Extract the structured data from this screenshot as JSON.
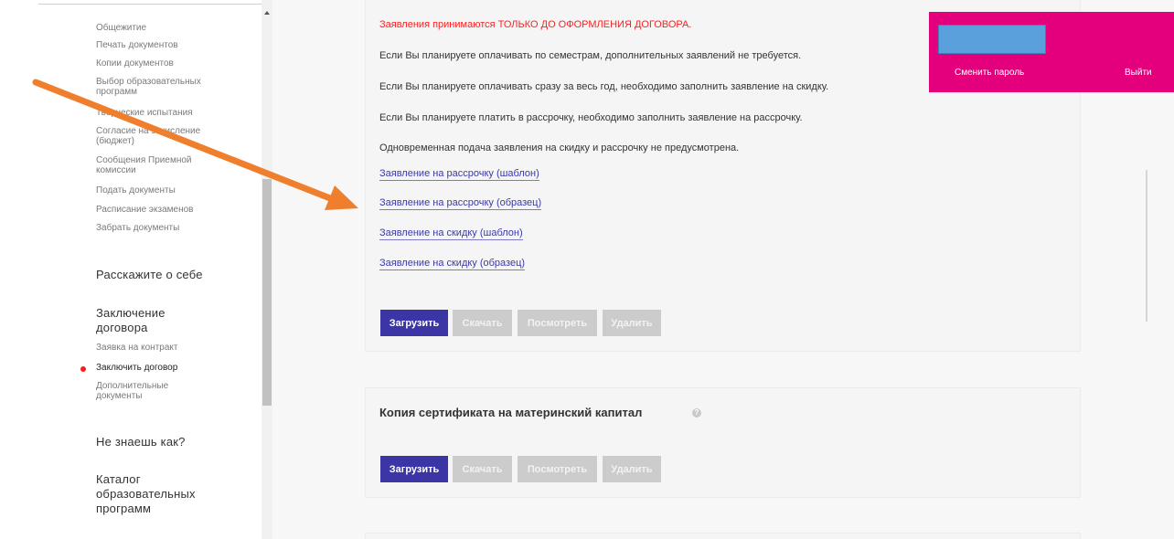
{
  "sidebar": {
    "nav_items": [
      {
        "label": "Общежитие"
      },
      {
        "label": "Печать документов"
      },
      {
        "label": "Копии документов"
      },
      {
        "label": "Выбор образовательных программ"
      },
      {
        "label": "Творческие испытания"
      },
      {
        "label": "Согласие на зачисление (бюджет)"
      },
      {
        "label": "Сообщения Приемной комиссии"
      },
      {
        "label": "Подать документы"
      },
      {
        "label": "Расписание экзаменов"
      },
      {
        "label": "Забрать документы"
      }
    ],
    "section_about": "Расскажите о себе",
    "section_contract": "Заключение договора",
    "contract_items": [
      {
        "label": "Заявка на контракт"
      },
      {
        "label": "Заключить договор",
        "active": true
      },
      {
        "label": "Дополнительные документы"
      }
    ],
    "section_help": "Не знаешь как?",
    "section_catalog": "Каталог образовательных программ"
  },
  "header": {
    "change_password": "Сменить пароль",
    "logout": "Выйти",
    "accent_color": "#e4007c"
  },
  "main": {
    "notice": "Заявления принимаются ТОЛЬКО ДО ОФОРМЛЕНИЯ ДОГОВОРА.",
    "info_lines": [
      "Если Вы планируете оплачивать по семестрам, дополнительных заявлений не требуется.",
      "Если Вы планируете оплачивать сразу за весь год, необходимо заполнить заявление на скидку.",
      "Если Вы планируете платить в рассрочку, необходимо заполнить заявление на рассрочку.",
      "Одновременная подача заявления на скидку и рассрочку не предусмотрена."
    ],
    "links": [
      "Заявление на рассрочку (шаблон)",
      "Заявление на рассрочку (образец)",
      "Заявление на скидку (шаблон)",
      "Заявление на скидку (образец)"
    ],
    "buttons": {
      "upload": "Загрузить",
      "download": "Скачать",
      "view": "Посмотреть",
      "delete": "Удалить"
    },
    "maternity_title": "Копия сертификата на материнский капитал",
    "primary_color": "#3b35a6",
    "annotation_arrow_color": "#f07f2d"
  }
}
